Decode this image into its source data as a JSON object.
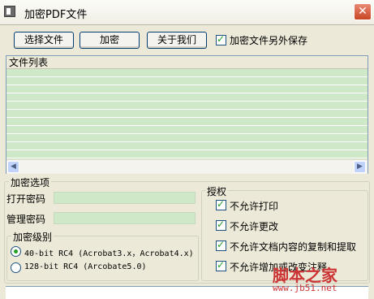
{
  "window": {
    "title": "加密PDF文件",
    "close_label": "✕"
  },
  "toolbar": {
    "select_file": "选择文件",
    "encrypt": "加密",
    "about": "关于我们",
    "save_elsewhere_label": "加密文件另外保存",
    "save_elsewhere_checked": true
  },
  "file_list": {
    "header": "文件列表"
  },
  "encrypt_options": {
    "title": "加密选项",
    "open_password_label": "打开密码",
    "open_password_value": "",
    "manage_password_label": "管理密码",
    "manage_password_value": ""
  },
  "encrypt_level": {
    "title": "加密级别",
    "options": [
      {
        "label": "40-bit RC4 (Acrobat3.x，Acrobat4.x)",
        "selected": true
      },
      {
        "label": "128-bit RC4 (Arcobate5.0)",
        "selected": false
      }
    ]
  },
  "permissions": {
    "title": "授权",
    "items": [
      {
        "label": "不允许打印",
        "checked": true
      },
      {
        "label": "不允许更改",
        "checked": true
      },
      {
        "label": "不允许文档内容的复制和提取",
        "checked": true
      },
      {
        "label": "不允许增加或改变注释",
        "checked": true
      }
    ]
  },
  "watermark": {
    "text": "脚本之家",
    "url": "www.jb51.net"
  },
  "colors": {
    "list_stripe": "#cfe9c8",
    "window_bg": "#ece9d8",
    "button_border": "#003c74"
  }
}
